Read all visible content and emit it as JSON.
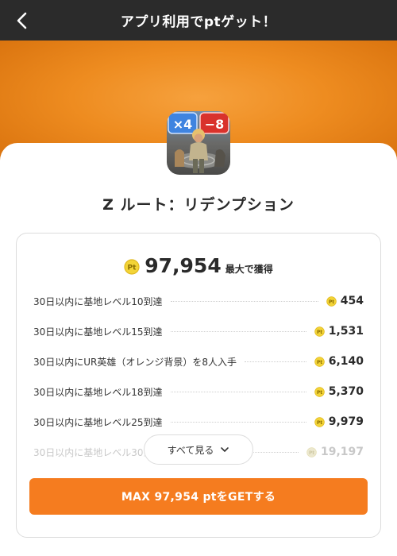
{
  "header": {
    "title": "アプリ利用でptゲット！"
  },
  "app": {
    "name": "Z ルート：リデンプション"
  },
  "summary": {
    "total": "97,954",
    "suffix": "最大で獲得"
  },
  "tasks": [
    {
      "label": "30日以内に基地レベル10到達",
      "points": "454"
    },
    {
      "label": "30日以内に基地レベル15到達",
      "points": "1,531"
    },
    {
      "label": "30日以内にUR英雄（オレンジ背景）を8人入手",
      "points": "6,140"
    },
    {
      "label": "30日以内に基地レベル18到達",
      "points": "5,370"
    },
    {
      "label": "30日以内に基地レベル25到達",
      "points": "9,979"
    },
    {
      "label": "30日以内に基地レベル30到達",
      "points": "19,197"
    }
  ],
  "see_all": {
    "label": "すべて見る"
  },
  "cta": {
    "label": "MAX 97,954 ptをGETする"
  },
  "icons": {
    "back": "chevron-left-icon",
    "coin": "pt-coin-icon",
    "expand": "chevron-down-icon"
  },
  "colors": {
    "header": "#2b2b2b",
    "accent": "#f57c1f",
    "hero": "#ee8c20",
    "coin": "#f3d437"
  }
}
